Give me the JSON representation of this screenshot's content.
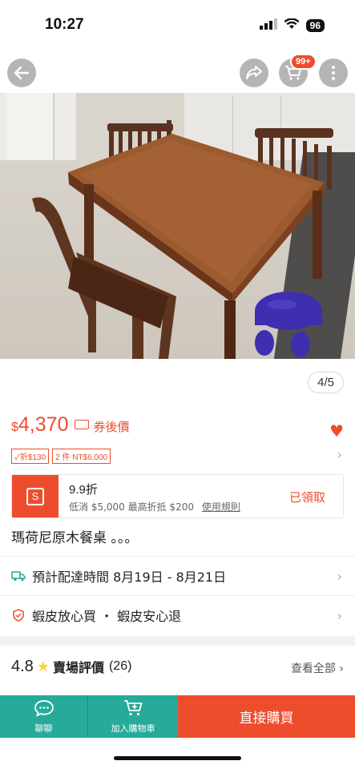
{
  "status_bar": {
    "time": "10:27",
    "battery": "96"
  },
  "nav": {
    "cart_badge": "99+"
  },
  "image": {
    "counter": "4/5"
  },
  "price": {
    "currency": "$",
    "value": "4,370",
    "coupon_label": "券後價"
  },
  "tags": [
    "✓折$130",
    "2 件 NT$6,000"
  ],
  "voucher": {
    "title": "9.9折",
    "subtitle": "低消 $5,000 最高折抵 $200",
    "rules_link": "使用規則",
    "claimed": "已領取"
  },
  "product": {
    "name": "瑪荷尼原木餐桌 。。。"
  },
  "delivery": {
    "text": "預計配達時間 8月19日 - 8月21日"
  },
  "guarantee": {
    "text": "蝦皮放心買 ・ 蝦皮安心退"
  },
  "rating": {
    "score": "4.8",
    "label": "賣場評價",
    "count": "(26)",
    "view_all": "查看全部"
  },
  "bottom_bar": {
    "chat_label": "聊聊",
    "cart_label": "加入購物車",
    "buy_label": "直接購買"
  },
  "colors": {
    "accent": "#ee4d2d",
    "teal": "#26aa99",
    "star": "#ffce3d"
  }
}
